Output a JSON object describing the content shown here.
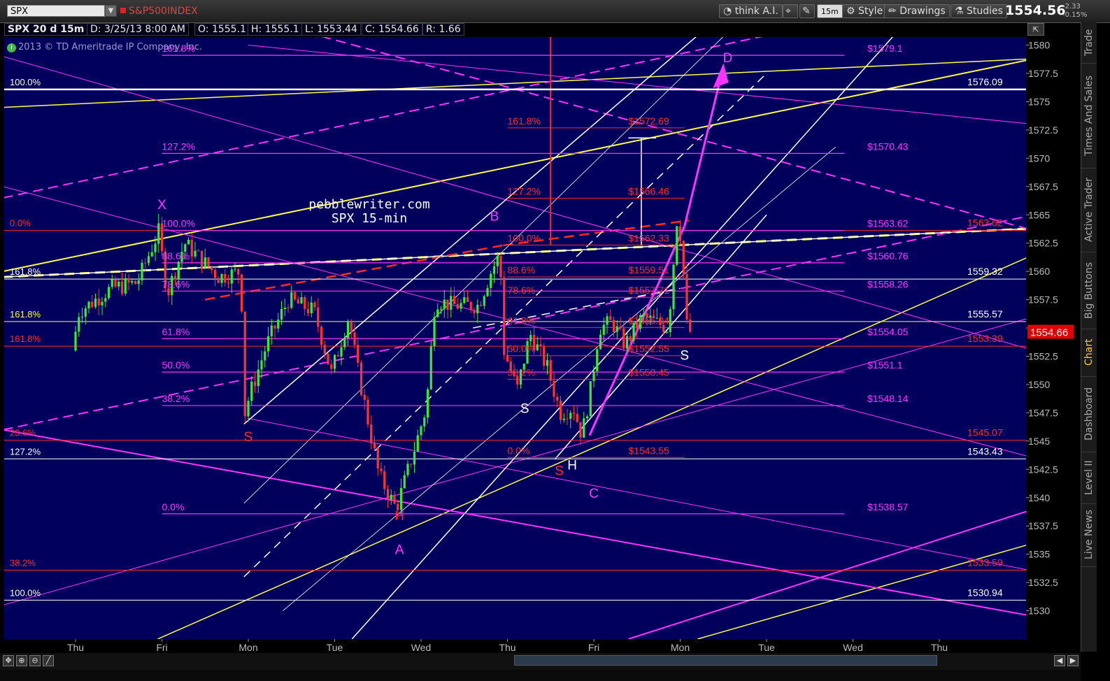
{
  "toolbar": {
    "symbol": "SPX",
    "index_name": "S&P500INDEX",
    "think_ai_label": "think A.I.",
    "timeframe_label": "15m",
    "style_label": "Style",
    "drawings_label": "Drawings",
    "studies_label": "Studies",
    "last_price": "1554.56",
    "change": "-2.33",
    "change_pct": "-0.15%"
  },
  "infobar": {
    "symbol_period": "SPX 20 d 15m",
    "date": "D: 3/25/13 8:00 AM",
    "open": "O: 1555.1",
    "high": "H: 1555.1",
    "low": "L: 1553.44",
    "close": "C: 1554.66",
    "range": "R: 1.66"
  },
  "copyright": "2013 © TD Ameritrade IP Company, Inc.",
  "watermark": {
    "line1": "pebblewriter.com",
    "line2": "SPX 15-min"
  },
  "side_tabs": [
    "Trade",
    "Times And Sales",
    "Active Trader",
    "Big Buttons",
    "Chart",
    "Dashboard",
    "Level II",
    "Live News"
  ],
  "colors": {
    "background": "#00005c",
    "magenta": "#ff33ff",
    "red": "#ff2a2a",
    "yellow": "#ffff44",
    "white": "#ffffff",
    "price_tag": "#e00000"
  },
  "chart_data": {
    "type": "candlestick",
    "symbol": "SPX",
    "interval": "15m",
    "period": "20 d",
    "ylim": [
      1527.5,
      1581
    ],
    "y_ticks": [
      1530,
      1532.5,
      1535,
      1537.5,
      1540,
      1542.5,
      1545,
      1547.5,
      1550,
      1552.5,
      1555,
      1557.5,
      1560,
      1562.5,
      1565,
      1567.5,
      1570,
      1572.5,
      1575,
      1577.5,
      1580
    ],
    "y_tick_labels": [
      "1530",
      "1532.5",
      "1535",
      "1537.5",
      "1540",
      "1542.5",
      "1545",
      "1547.5",
      "1550",
      "1552.5",
      "1555",
      "1557.5",
      "1560",
      "1562.5",
      "1565",
      "1567.5",
      "1570",
      "1572.5",
      "1575",
      "1577.5",
      "1580"
    ],
    "x_tick_labels": [
      "Thu",
      "Fri",
      "Mon",
      "Tue",
      "Wed",
      "Thu",
      "Fri",
      "Mon",
      "Tue",
      "Wed",
      "Thu"
    ],
    "current_price": 1554.66,
    "price_path": [
      [
        0,
        1553.0
      ],
      [
        0.08,
        1556.5
      ],
      [
        0.18,
        1557.0
      ],
      [
        0.45,
        1558.5
      ],
      [
        0.75,
        1559.0
      ],
      [
        1.0,
        1563.5
      ],
      [
        1.1,
        1558.0
      ],
      [
        1.3,
        1562.5
      ],
      [
        1.5,
        1561.0
      ],
      [
        1.7,
        1559.5
      ],
      [
        1.95,
        1560.0
      ],
      [
        2.0,
        1547.5
      ],
      [
        2.05,
        1549.0
      ],
      [
        2.25,
        1553.5
      ],
      [
        2.5,
        1557.5
      ],
      [
        2.8,
        1556.5
      ],
      [
        3.0,
        1551.0
      ],
      [
        3.2,
        1556.0
      ],
      [
        3.3,
        1551.5
      ],
      [
        3.55,
        1542.0
      ],
      [
        3.75,
        1539.0
      ],
      [
        3.95,
        1544.0
      ],
      [
        4.1,
        1548.0
      ],
      [
        4.2,
        1557.5
      ],
      [
        4.4,
        1557.0
      ],
      [
        4.7,
        1557.0
      ],
      [
        4.85,
        1560.0
      ],
      [
        4.95,
        1561.5
      ],
      [
        5.0,
        1553.0
      ],
      [
        5.15,
        1549.5
      ],
      [
        5.3,
        1554.5
      ],
      [
        5.5,
        1551.5
      ],
      [
        5.65,
        1547.5
      ],
      [
        5.8,
        1548.0
      ],
      [
        5.9,
        1545.5
      ],
      [
        6.0,
        1549.5
      ],
      [
        6.1,
        1555.0
      ],
      [
        6.25,
        1555.5
      ],
      [
        6.4,
        1553.5
      ],
      [
        6.6,
        1556.0
      ],
      [
        6.9,
        1555.0
      ],
      [
        7.0,
        1564.5
      ],
      [
        7.05,
        1563.0
      ],
      [
        7.1,
        1557.0
      ],
      [
        7.12,
        1554.66
      ]
    ],
    "horizontal_levels": [
      {
        "value": 1576.09,
        "label": "1576.09",
        "left_label": "100.0%",
        "color": "white"
      },
      {
        "value": 1559.32,
        "label": "1559.32",
        "left_label": "161.8%",
        "color": "white"
      },
      {
        "value": 1555.57,
        "label": "1555.57",
        "left_label": "161.8%",
        "color": "yellow"
      },
      {
        "value": 1543.43,
        "label": "1543.43",
        "left_label": "127.2%",
        "color": "white"
      },
      {
        "value": 1530.94,
        "label": "1530.94",
        "left_label": "100.0%",
        "color": "white"
      },
      {
        "value": 1563.62,
        "label": "1563.62",
        "left_label": "0.0%",
        "color": "red"
      },
      {
        "value": 1553.39,
        "label": "1553.39",
        "left_label": "161.8%",
        "color": "red"
      },
      {
        "value": 1545.07,
        "label": "1545.07",
        "left_label": "23.6%",
        "color": "red"
      },
      {
        "value": 1533.59,
        "label": "1533.59",
        "left_label": "38.2%",
        "color": "red"
      }
    ],
    "magenta_fib": [
      {
        "value": 1579.1,
        "label": "$1579.1",
        "pct": "161.8%"
      },
      {
        "value": 1570.43,
        "label": "$1570.43",
        "pct": "127.2%"
      },
      {
        "value": 1563.62,
        "label": "$1563.62",
        "pct": "100.0%"
      },
      {
        "value": 1560.76,
        "label": "$1560.76",
        "pct": "88.6%"
      },
      {
        "value": 1558.26,
        "label": "$1558.26",
        "pct": "78.6%"
      },
      {
        "value": 1554.05,
        "label": "$1554.05",
        "pct": "61.8%"
      },
      {
        "value": 1551.1,
        "label": "$1551.1",
        "pct": "50.0%"
      },
      {
        "value": 1548.14,
        "label": "$1548.14",
        "pct": "38.2%"
      },
      {
        "value": 1538.57,
        "label": "$1538.57",
        "pct": "0.0%"
      }
    ],
    "red_fib": [
      {
        "value": 1572.69,
        "label": "$1572.69",
        "pct": "161.8%"
      },
      {
        "value": 1566.46,
        "label": "$1566.46",
        "pct": "127.2%"
      },
      {
        "value": 1562.33,
        "label": "$1562.33",
        "pct": "100.0%"
      },
      {
        "value": 1559.51,
        "label": "$1559.51",
        "pct": "88.6%"
      },
      {
        "value": 1557.71,
        "label": "$1557.71",
        "pct": "78.6%"
      },
      {
        "value": 1555.04,
        "label": "$1555.04",
        "pct": "61.8%"
      },
      {
        "value": 1552.55,
        "label": "$1552.55",
        "pct": "50.0%"
      },
      {
        "value": 1550.45,
        "label": "$1550.45",
        "pct": "38.2%"
      },
      {
        "value": 1543.55,
        "label": "$1543.55",
        "pct": "0.0%"
      }
    ],
    "pattern_points": [
      {
        "label": "X",
        "x": 1.0,
        "y": 1565.5,
        "color": "magenta"
      },
      {
        "label": "A",
        "x": 3.75,
        "y": 1535.0,
        "color": "magenta"
      },
      {
        "label": "B",
        "x": 4.85,
        "y": 1564.5,
        "color": "magenta"
      },
      {
        "label": "C",
        "x": 6.0,
        "y": 1540.0,
        "color": "magenta"
      },
      {
        "label": "D",
        "x": 7.55,
        "y": 1578.5,
        "color": "magenta"
      },
      {
        "label": "S",
        "x": 2.0,
        "y": 1545.0,
        "color": "red"
      },
      {
        "label": "H",
        "x": 3.75,
        "y": 1538.0,
        "color": "red"
      },
      {
        "label": "S",
        "x": 5.6,
        "y": 1542.0,
        "color": "red"
      },
      {
        "label": "S",
        "x": 5.2,
        "y": 1547.5,
        "color": "white"
      },
      {
        "label": "H",
        "x": 5.75,
        "y": 1542.5,
        "color": "white"
      },
      {
        "label": "S",
        "x": 7.05,
        "y": 1552.2,
        "color": "white"
      }
    ]
  }
}
